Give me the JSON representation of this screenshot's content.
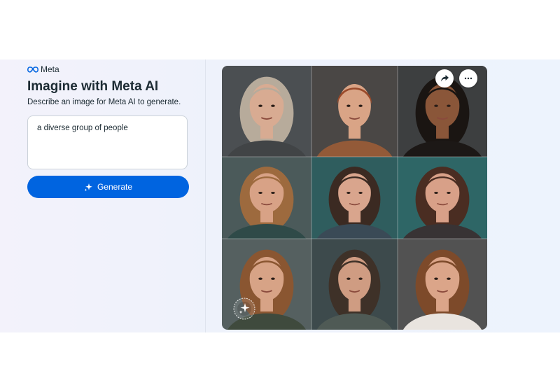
{
  "brand": {
    "logo_text": "Meta"
  },
  "header": {
    "title": "Imagine with Meta AI",
    "subtitle": "Describe an image for Meta AI to generate."
  },
  "prompt": {
    "value": "a diverse group of people"
  },
  "actions": {
    "generate_label": "Generate"
  },
  "colors": {
    "accent": "#0064e0",
    "text": "#1c2b33"
  },
  "icons": {
    "share": "share-arrow-icon",
    "more": "more-horizontal-icon",
    "generate": "sparkle-icon",
    "watermark": "imagined-with-ai-badge-icon"
  },
  "grid": {
    "images": [
      {
        "bg": "#4b4f52",
        "skin": "#d8ab92",
        "hair": "#b7ab9b",
        "shirt": "#414446",
        "long_hair": true
      },
      {
        "bg": "#4a4745",
        "skin": "#d9a486",
        "hair": "#9a4a2a",
        "shirt": "#935a38",
        "long_hair": false
      },
      {
        "bg": "#3d3f40",
        "skin": "#8a5639",
        "hair": "#1a1512",
        "shirt": "#1c1816",
        "long_hair": true
      },
      {
        "bg": "#4b5a5a",
        "skin": "#d8a286",
        "hair": "#9d6a3e",
        "shirt": "#2f4a48",
        "long_hair": true
      },
      {
        "bg": "#2f5d5e",
        "skin": "#d9a58d",
        "hair": "#3b2a22",
        "shirt": "#3a4a56",
        "long_hair": true
      },
      {
        "bg": "#2e6666",
        "skin": "#d8a088",
        "hair": "#4a2d22",
        "shirt": "#383334",
        "long_hair": true
      },
      {
        "bg": "#556060",
        "skin": "#d7a386",
        "hair": "#8a5631",
        "shirt": "#3f4a3d",
        "long_hair": true
      },
      {
        "bg": "#3d4a4c",
        "skin": "#cf9c82",
        "hair": "#3e3128",
        "shirt": "#4f5a55",
        "long_hair": true
      },
      {
        "bg": "#525252",
        "skin": "#dba589",
        "hair": "#7d4a2a",
        "shirt": "#e9e4df",
        "long_hair": true
      }
    ]
  }
}
